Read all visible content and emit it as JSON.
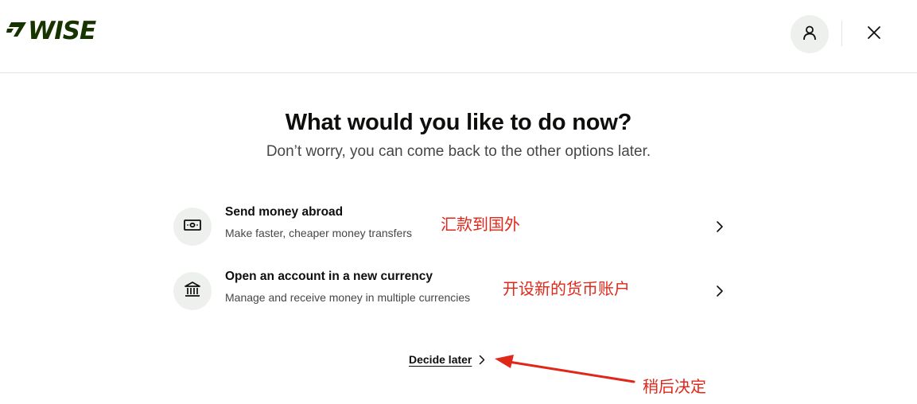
{
  "header": {
    "logo_text": "WISE",
    "profile_icon": "user-icon",
    "close_icon": "close-icon"
  },
  "main": {
    "title": "What would you like to do now?",
    "subtitle": "Don’t worry, you can come back to the other options later."
  },
  "options": [
    {
      "icon": "banknote-icon",
      "title": "Send money abroad",
      "description": "Make faster, cheaper money transfers",
      "annotation": "汇款到国外"
    },
    {
      "icon": "bank-icon",
      "title": "Open an account in a new currency",
      "description": "Manage and receive money in multiple currencies",
      "annotation": "开设新的货币账户"
    }
  ],
  "decide_later": {
    "label": "Decide later",
    "annotation": "稍后决定"
  },
  "colors": {
    "brand_green": "#163300",
    "annotation_red": "#e0271a",
    "icon_bg": "#eef0ed",
    "text_primary": "#0e0f0c",
    "text_secondary": "#454745"
  }
}
